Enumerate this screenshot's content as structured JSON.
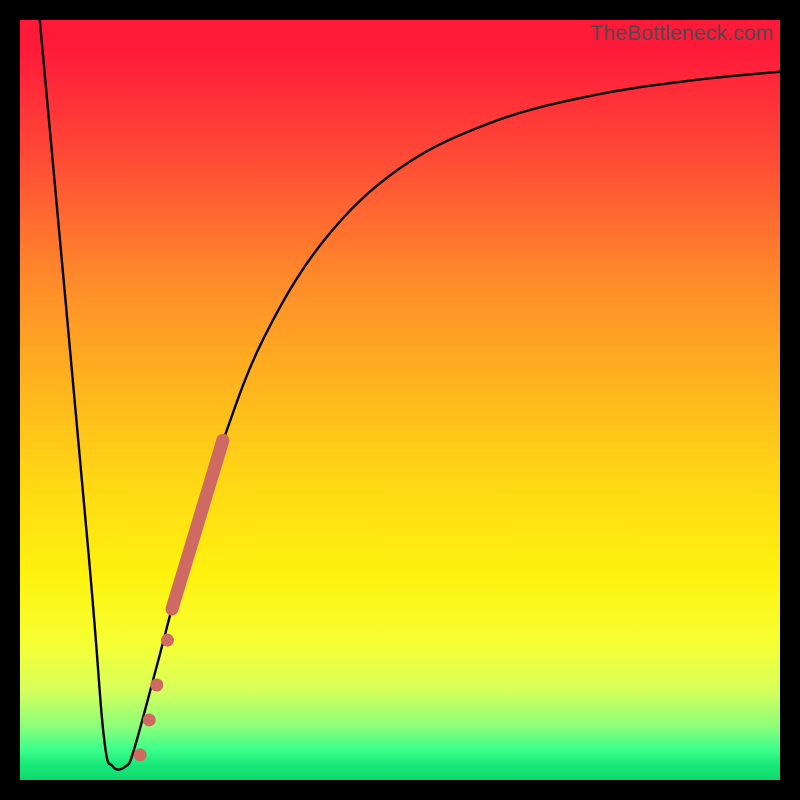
{
  "attribution": "TheBottleneck.com",
  "colors": {
    "line": "#000000",
    "dots": "#cf6a63",
    "frame": "#000000"
  },
  "chart_data": {
    "type": "line",
    "title": "",
    "xlabel": "",
    "ylabel": "",
    "x_range": [
      0,
      100
    ],
    "y_range": [
      0,
      100
    ],
    "note": "No axis ticks or numeric labels are visible; values are estimated in chart-percent coordinates (0–100 on each axis) from pixel positions.",
    "series": [
      {
        "name": "curve",
        "style": "line",
        "color": "#000000",
        "points": [
          {
            "x": 2.6,
            "y": 100.0
          },
          {
            "x": 9.0,
            "y": 30.0
          },
          {
            "x": 11.0,
            "y": 6.0
          },
          {
            "x": 12.2,
            "y": 1.8
          },
          {
            "x": 13.9,
            "y": 1.8
          },
          {
            "x": 15.0,
            "y": 4.0
          },
          {
            "x": 18.0,
            "y": 15.0
          },
          {
            "x": 22.0,
            "y": 30.0
          },
          {
            "x": 26.5,
            "y": 44.0
          },
          {
            "x": 32.0,
            "y": 58.0
          },
          {
            "x": 40.0,
            "y": 71.0
          },
          {
            "x": 50.0,
            "y": 80.5
          },
          {
            "x": 62.0,
            "y": 86.5
          },
          {
            "x": 75.0,
            "y": 90.0
          },
          {
            "x": 88.0,
            "y": 92.0
          },
          {
            "x": 100.0,
            "y": 93.2
          }
        ]
      },
      {
        "name": "highlight-band",
        "style": "thick-line",
        "color": "#cf6a63",
        "points": [
          {
            "x": 20.0,
            "y": 22.5
          },
          {
            "x": 26.7,
            "y": 44.7
          }
        ]
      },
      {
        "name": "dots",
        "style": "scatter",
        "color": "#cf6a63",
        "points": [
          {
            "x": 15.8,
            "y": 3.3
          },
          {
            "x": 17.0,
            "y": 7.9
          },
          {
            "x": 18.0,
            "y": 12.5
          },
          {
            "x": 19.4,
            "y": 18.4
          }
        ]
      }
    ]
  }
}
